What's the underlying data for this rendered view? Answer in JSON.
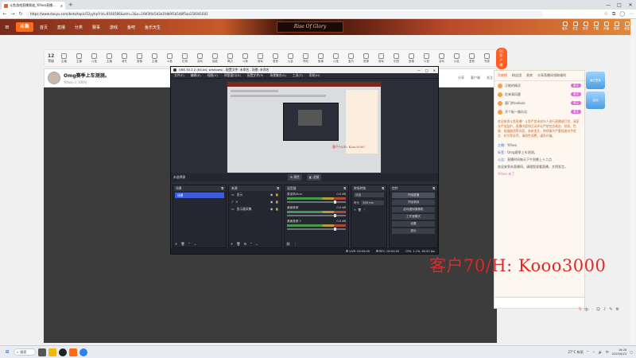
{
  "browser": {
    "tab_title": "斗鱼游戏直播频道_Yilhoo直播...",
    "new_tab": "+",
    "url": "https://www.douyu.com/beta/topic/12yyhp?rid=9166566&utm=3&x=1fbf3f4c5d3a1fdb9f1b5d8f5aa150041601",
    "window_controls": [
      "—",
      "□",
      "✕"
    ]
  },
  "site": {
    "logo": "斗鱼",
    "nav": [
      "首页",
      "直播",
      "分类",
      "赛事",
      "游戏",
      "鱼吧",
      "鱼乐天生"
    ],
    "banner": "Rise Of Glory",
    "header_icons": [
      "鱼丸",
      "关注",
      "历史",
      "下载",
      "开播",
      "签到",
      "消息"
    ]
  },
  "category_bar": {
    "level_num": "12",
    "level_label": "等级",
    "items": [
      "主播",
      "主播",
      "斗宝",
      "主播",
      "消失",
      "宝箱",
      "主播",
      "斗鱼",
      "礼物",
      "活动",
      "抽奖",
      "周边",
      "斗鱼",
      "冠军",
      "语音",
      "公会",
      "导航",
      "鱼塘",
      "斗宝",
      "宝贝",
      "竞猜",
      "冠军",
      "乐园",
      "宝箱",
      "斗宝",
      "活动",
      "公会",
      "语音",
      "专属"
    ],
    "pc_button": "PC客户端"
  },
  "room": {
    "title": "Omg赛季上车测测。",
    "meta": "Yilhoo  ⊙ 100%",
    "right_items": [
      "分享",
      "客户端",
      "关注"
    ]
  },
  "obs": {
    "title": "OBS 30.2.2 (64-bit, windows) - 配置文件: 未命名 - 场景: 未命名",
    "menu": [
      "文件(F)",
      "编辑(E)",
      "视图(V)",
      "停靠窗口(D)",
      "配置文件(P)",
      "场景集合(S)",
      "工具(T)",
      "帮助(H)"
    ],
    "window_controls": [
      "—",
      "□",
      "✕"
    ],
    "source_bar_label": "未选择源",
    "properties_btn": "属性",
    "filters_btn": "滤镜",
    "docks": {
      "scenes": {
        "title": "场景",
        "items": [
          "场景"
        ]
      },
      "sources": {
        "title": "来源",
        "items": [
          "显示",
          "V",
          "显示器采集"
        ]
      },
      "mixer": {
        "title": "混音器",
        "channels": [
          {
            "name": "麦克风/Aux",
            "level": "0.0 dB"
          },
          {
            "name": "桌面音频",
            "level": "0.0 dB"
          },
          {
            "name": "桌面音频 2",
            "level": "0.0 dB"
          }
        ]
      },
      "transitions": {
        "title": "转场特效",
        "type": "淡出",
        "duration_label": "时长",
        "duration": "300 ms"
      },
      "controls": {
        "title": "控件",
        "buttons": [
          "开始直播",
          "开始录制",
          "启动虚拟摄像机",
          "工作室模式",
          "设置",
          "退出"
        ]
      }
    },
    "status": {
      "live": "LIVE: 00:00:00",
      "rec": "REC: 00:00:00",
      "cpu": "CPU: 1.1%, 60.00 fps"
    },
    "preview_watermark": "客户70/H: Kooo3000"
  },
  "chat": {
    "tabs": [
      "贡献榜",
      "粉丝团",
      "贵宾",
      "分享直播间领取福利"
    ],
    "ranks": [
      {
        "name": "汪眼的精灵",
        "pill": "金主"
      },
      {
        "name": "往来清风客",
        "pill": "金主"
      },
      {
        "name": "唐门的nebula",
        "pill": "金主"
      },
      {
        "name": "开个板一路向北",
        "pill": "金主"
      }
    ],
    "notice": "欢迎来到斗鱼直播！斗鱼严禁未成年人进行直播或打赏，请家长严加监护。直播内容和互动评论严禁包含政治、低俗、色情、吸烟酗酒等内容，若有违反，将视情节严重程度给予禁言、封号等处罚。请理性消费，谨防诈骗。",
    "messages": [
      {
        "name": "主播",
        "text": "Yilhoo"
      },
      {
        "name": "标签",
        "text": "Omg赛季上车测测。"
      },
      {
        "name": "公告",
        "text": "直播时间每天下午到晚上十二点"
      },
      {
        "name": "",
        "text": "欢迎来到本直播间，请理智观看直播，文明发言。"
      }
    ],
    "gift_msg": "Yilhoo 来了"
  },
  "side_icons": [
    "每日签到",
    "活动"
  ],
  "bottom_icons": [
    "S",
    "中",
    "·",
    "☺",
    "♪",
    "✎",
    "⚙"
  ],
  "watermark": "客户70/H: Kooo3000",
  "taskbar": {
    "start": "⊞",
    "search": "搜索",
    "weather": "27°C 有雨",
    "time": "16:28",
    "date": "2025/6/23",
    "lang": "中"
  }
}
